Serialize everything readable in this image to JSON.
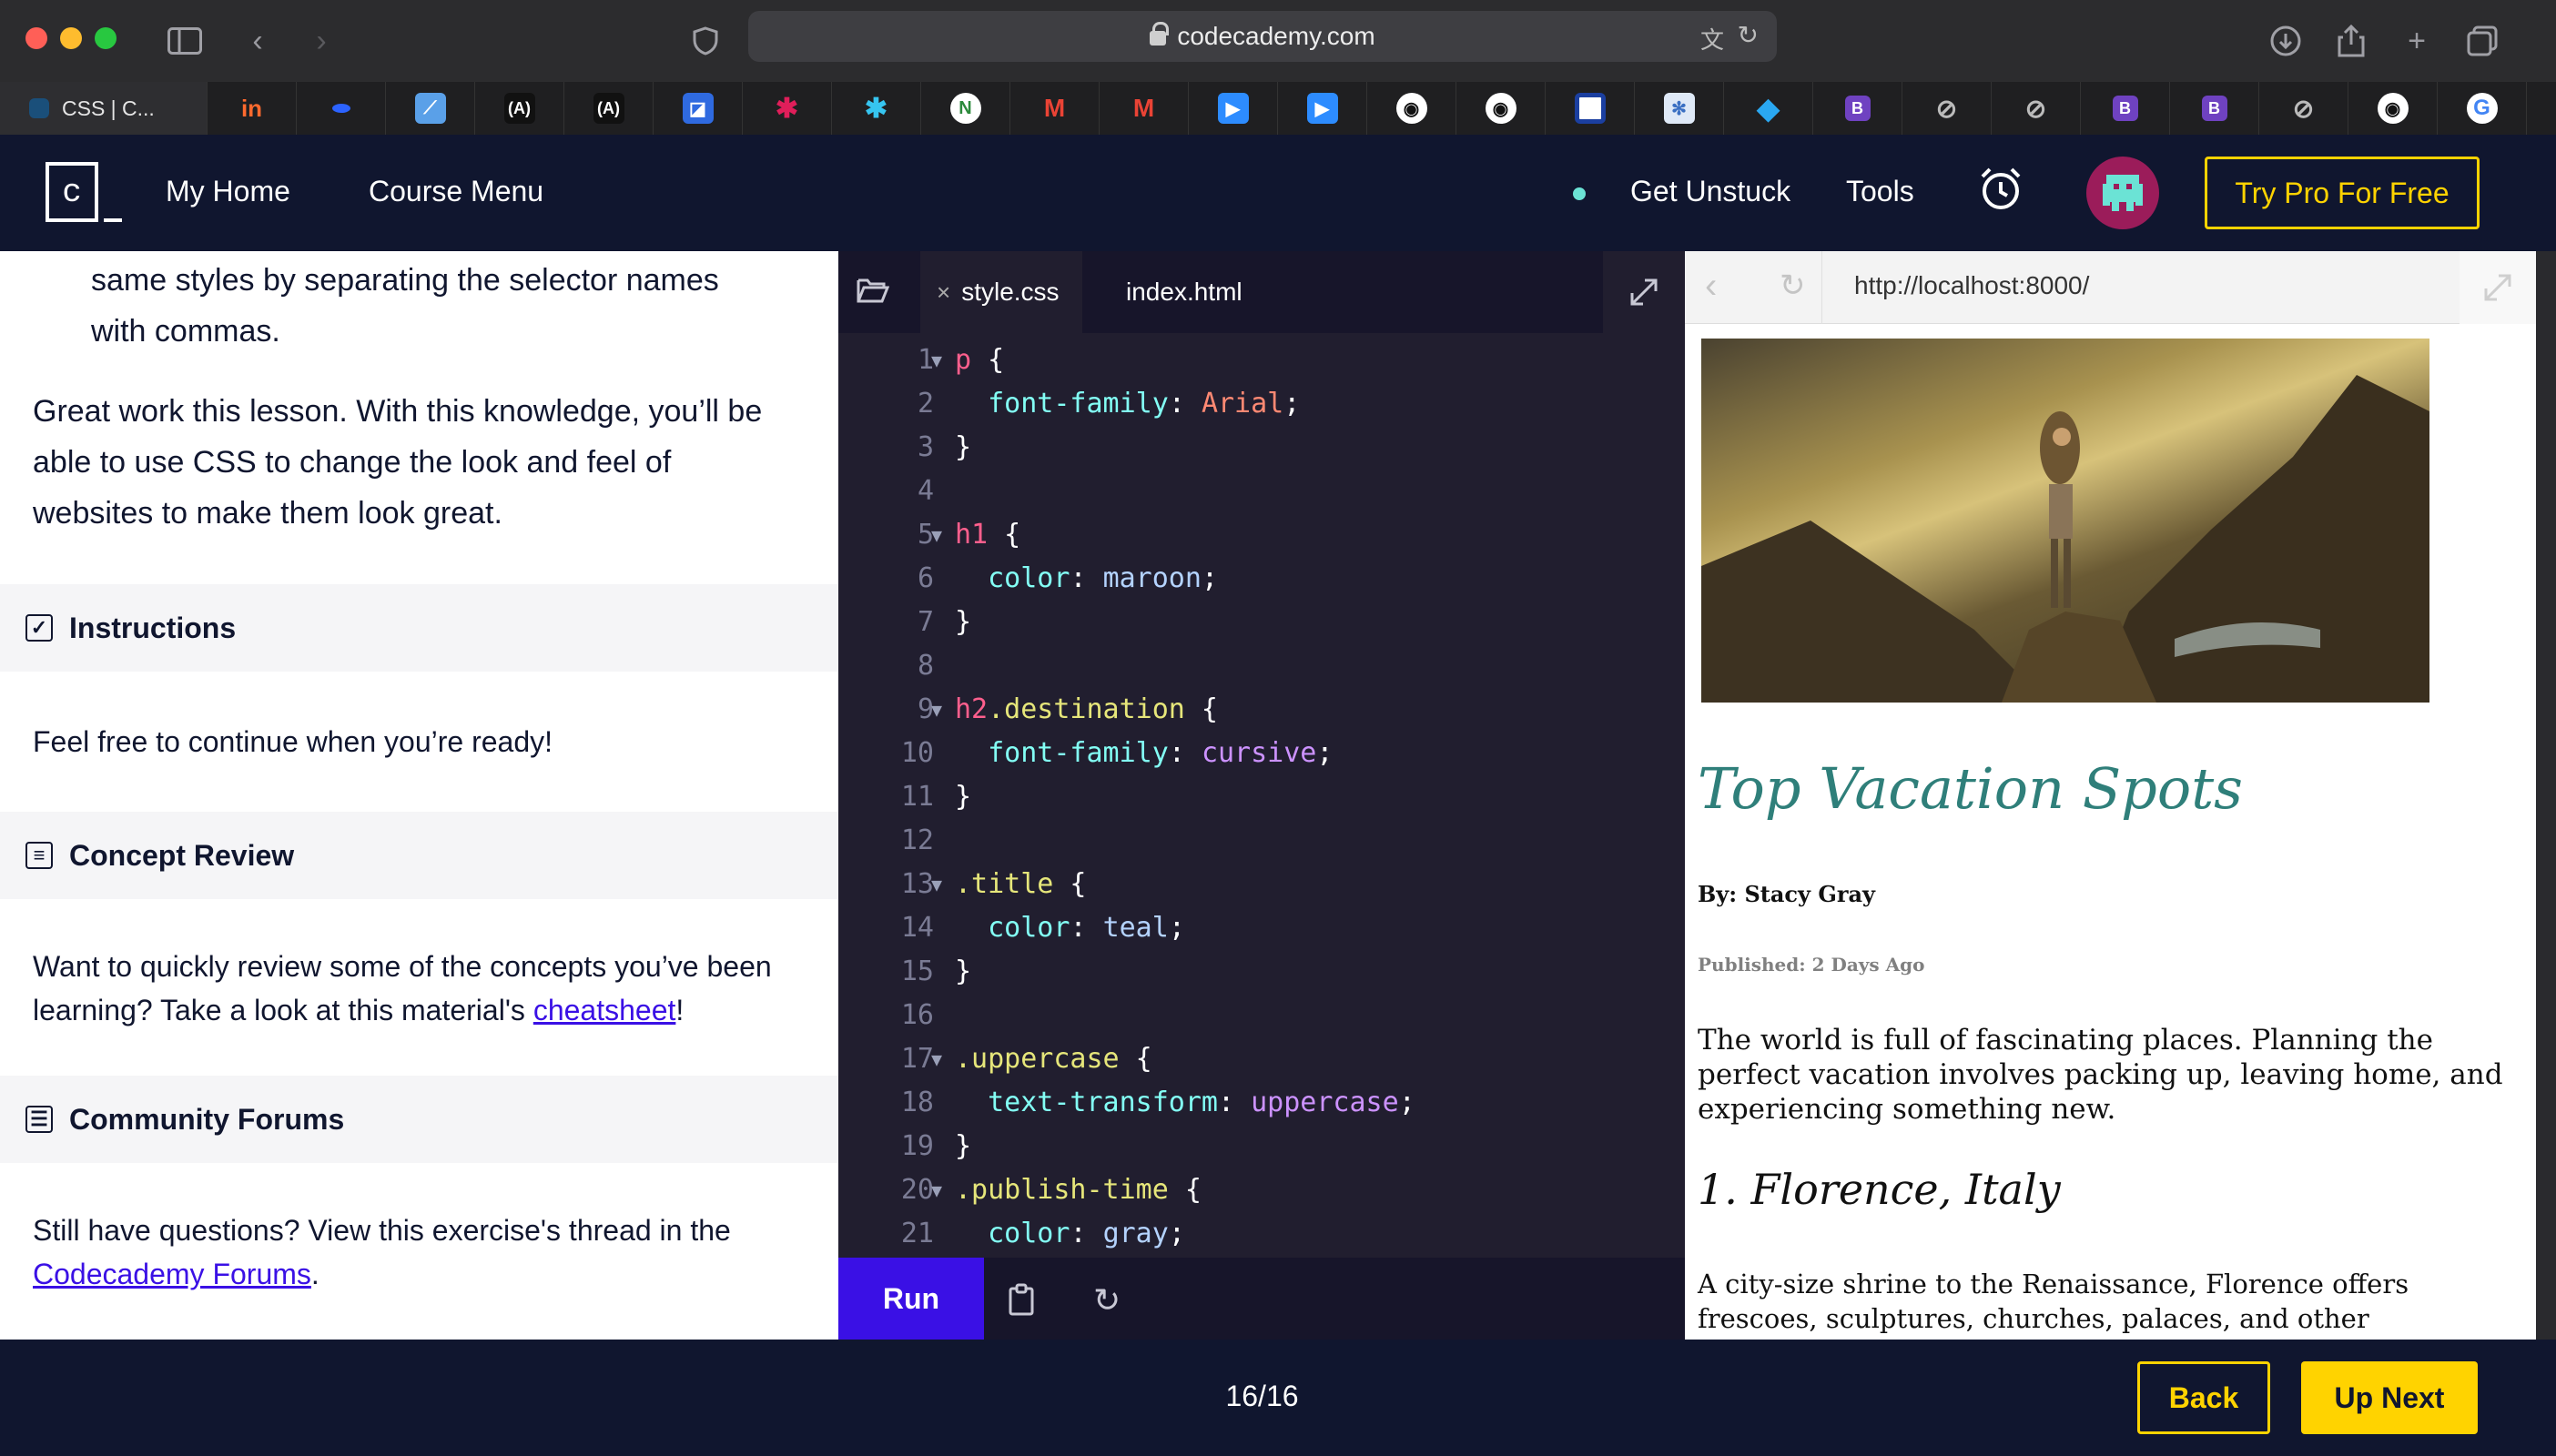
{
  "browser": {
    "url": "codecademy.com",
    "active_tab_title": "CSS | C...",
    "favicons": [
      "invision",
      "blue-dot",
      "chart",
      "ab-logo",
      "ab-logo",
      "frame",
      "slack",
      "slack",
      "n-logo",
      "gmail",
      "gmail",
      "zoom",
      "zoom",
      "github",
      "github",
      "square",
      "snowflake",
      "diamond",
      "B",
      "compass",
      "compass",
      "B",
      "B",
      "compass",
      "github",
      "google"
    ]
  },
  "header": {
    "logo_letter": "c",
    "my_home": "My Home",
    "course_menu": "Course Menu",
    "get_unstuck": "Get Unstuck",
    "tools": "Tools",
    "pro_button": "Try Pro For Free"
  },
  "learn": {
    "intro_tail_1": "same styles by separating the selector names",
    "intro_tail_2": "with commas.",
    "wrap_up": [
      "Great work this lesson. With this knowledge, you’ll be",
      "able to use CSS to change the look and feel of",
      "websites to make them look great."
    ],
    "instructions_title": "Instructions",
    "instructions_text": "Feel free to continue when you’re ready!",
    "concept_title": "Concept Review",
    "concept_text_1": "Want to quickly review some of the concepts you’ve been",
    "concept_text_2a": "learning? Take a look at this material's ",
    "concept_link": "cheatsheet",
    "concept_text_2b": "!",
    "forums_title": "Community Forums",
    "forums_text_1": "Still have questions? View this exercise's thread in the",
    "forums_link": "Codecademy Forums",
    "forums_text_2": "."
  },
  "editor": {
    "tabs": [
      "style.css",
      "index.html"
    ],
    "close_mark": "×",
    "lines": [
      {
        "n": "1",
        "fold": true,
        "parts": [
          [
            "sel-tag",
            "p"
          ],
          [
            "punc",
            " {"
          ]
        ]
      },
      {
        "n": "2",
        "fold": false,
        "parts": [
          [
            "punc",
            "  "
          ],
          [
            "prop",
            "font-family"
          ],
          [
            "punc",
            ": "
          ],
          [
            "val-kw",
            "Arial"
          ],
          [
            "punc",
            ";"
          ]
        ]
      },
      {
        "n": "3",
        "fold": false,
        "parts": [
          [
            "punc",
            "}"
          ]
        ]
      },
      {
        "n": "4",
        "fold": false,
        "parts": []
      },
      {
        "n": "5",
        "fold": true,
        "parts": [
          [
            "sel-tag",
            "h1"
          ],
          [
            "punc",
            " {"
          ]
        ]
      },
      {
        "n": "6",
        "fold": false,
        "parts": [
          [
            "punc",
            "  "
          ],
          [
            "prop",
            "color"
          ],
          [
            "punc",
            ": "
          ],
          [
            "val",
            "maroon"
          ],
          [
            "punc",
            ";"
          ]
        ]
      },
      {
        "n": "7",
        "fold": false,
        "parts": [
          [
            "punc",
            "}"
          ]
        ]
      },
      {
        "n": "8",
        "fold": false,
        "parts": []
      },
      {
        "n": "9",
        "fold": true,
        "parts": [
          [
            "sel-tag",
            "h2"
          ],
          [
            "sel-cls",
            ".destination"
          ],
          [
            "punc",
            " {"
          ]
        ]
      },
      {
        "n": "10",
        "fold": false,
        "parts": [
          [
            "punc",
            "  "
          ],
          [
            "prop",
            "font-family"
          ],
          [
            "punc",
            ": "
          ],
          [
            "val-fn",
            "cursive"
          ],
          [
            "punc",
            ";"
          ]
        ]
      },
      {
        "n": "11",
        "fold": false,
        "parts": [
          [
            "punc",
            "}"
          ]
        ]
      },
      {
        "n": "12",
        "fold": false,
        "parts": []
      },
      {
        "n": "13",
        "fold": true,
        "parts": [
          [
            "sel-cls",
            ".title"
          ],
          [
            "punc",
            " {"
          ]
        ]
      },
      {
        "n": "14",
        "fold": false,
        "parts": [
          [
            "punc",
            "  "
          ],
          [
            "prop",
            "color"
          ],
          [
            "punc",
            ": "
          ],
          [
            "val",
            "teal"
          ],
          [
            "punc",
            ";"
          ]
        ]
      },
      {
        "n": "15",
        "fold": false,
        "parts": [
          [
            "punc",
            "}"
          ]
        ]
      },
      {
        "n": "16",
        "fold": false,
        "parts": []
      },
      {
        "n": "17",
        "fold": true,
        "parts": [
          [
            "sel-cls",
            ".uppercase"
          ],
          [
            "punc",
            " {"
          ]
        ]
      },
      {
        "n": "18",
        "fold": false,
        "parts": [
          [
            "punc",
            "  "
          ],
          [
            "prop",
            "text-transform"
          ],
          [
            "punc",
            ": "
          ],
          [
            "val-fn",
            "uppercase"
          ],
          [
            "punc",
            ";"
          ]
        ]
      },
      {
        "n": "19",
        "fold": false,
        "parts": [
          [
            "punc",
            "}"
          ]
        ]
      },
      {
        "n": "20",
        "fold": true,
        "parts": [
          [
            "sel-cls",
            ".publish-time"
          ],
          [
            "punc",
            " {"
          ]
        ]
      },
      {
        "n": "21",
        "fold": false,
        "parts": [
          [
            "punc",
            "  "
          ],
          [
            "prop",
            "color"
          ],
          [
            "punc",
            ": "
          ],
          [
            "val",
            "gray"
          ],
          [
            "punc",
            ";"
          ]
        ]
      }
    ],
    "run_label": "Run"
  },
  "preview": {
    "url": "http://localhost:8000/",
    "title": "Top Vacation Spots",
    "byline": "By: Stacy Gray",
    "published": "Published: 2 Days Ago",
    "intro": "The world is full of fascinating places. Planning the perfect vacation involves packing up, leaving home, and experiencing something new.",
    "dest1": "1. Florence, Italy",
    "dest1_text": "A city-size shrine to the Renaissance, Florence offers frescoes, sculptures, churches, palaces, and other monuments from the richest"
  },
  "footer": {
    "progress": "16/16",
    "back": "Back",
    "next": "Up Next"
  },
  "colors": {
    "brand_navy": "#10162f",
    "accent_yellow": "#ffd300",
    "run_purple": "#3a10e5",
    "teal_title": "#2f7f7a",
    "link": "#3a10e5"
  }
}
